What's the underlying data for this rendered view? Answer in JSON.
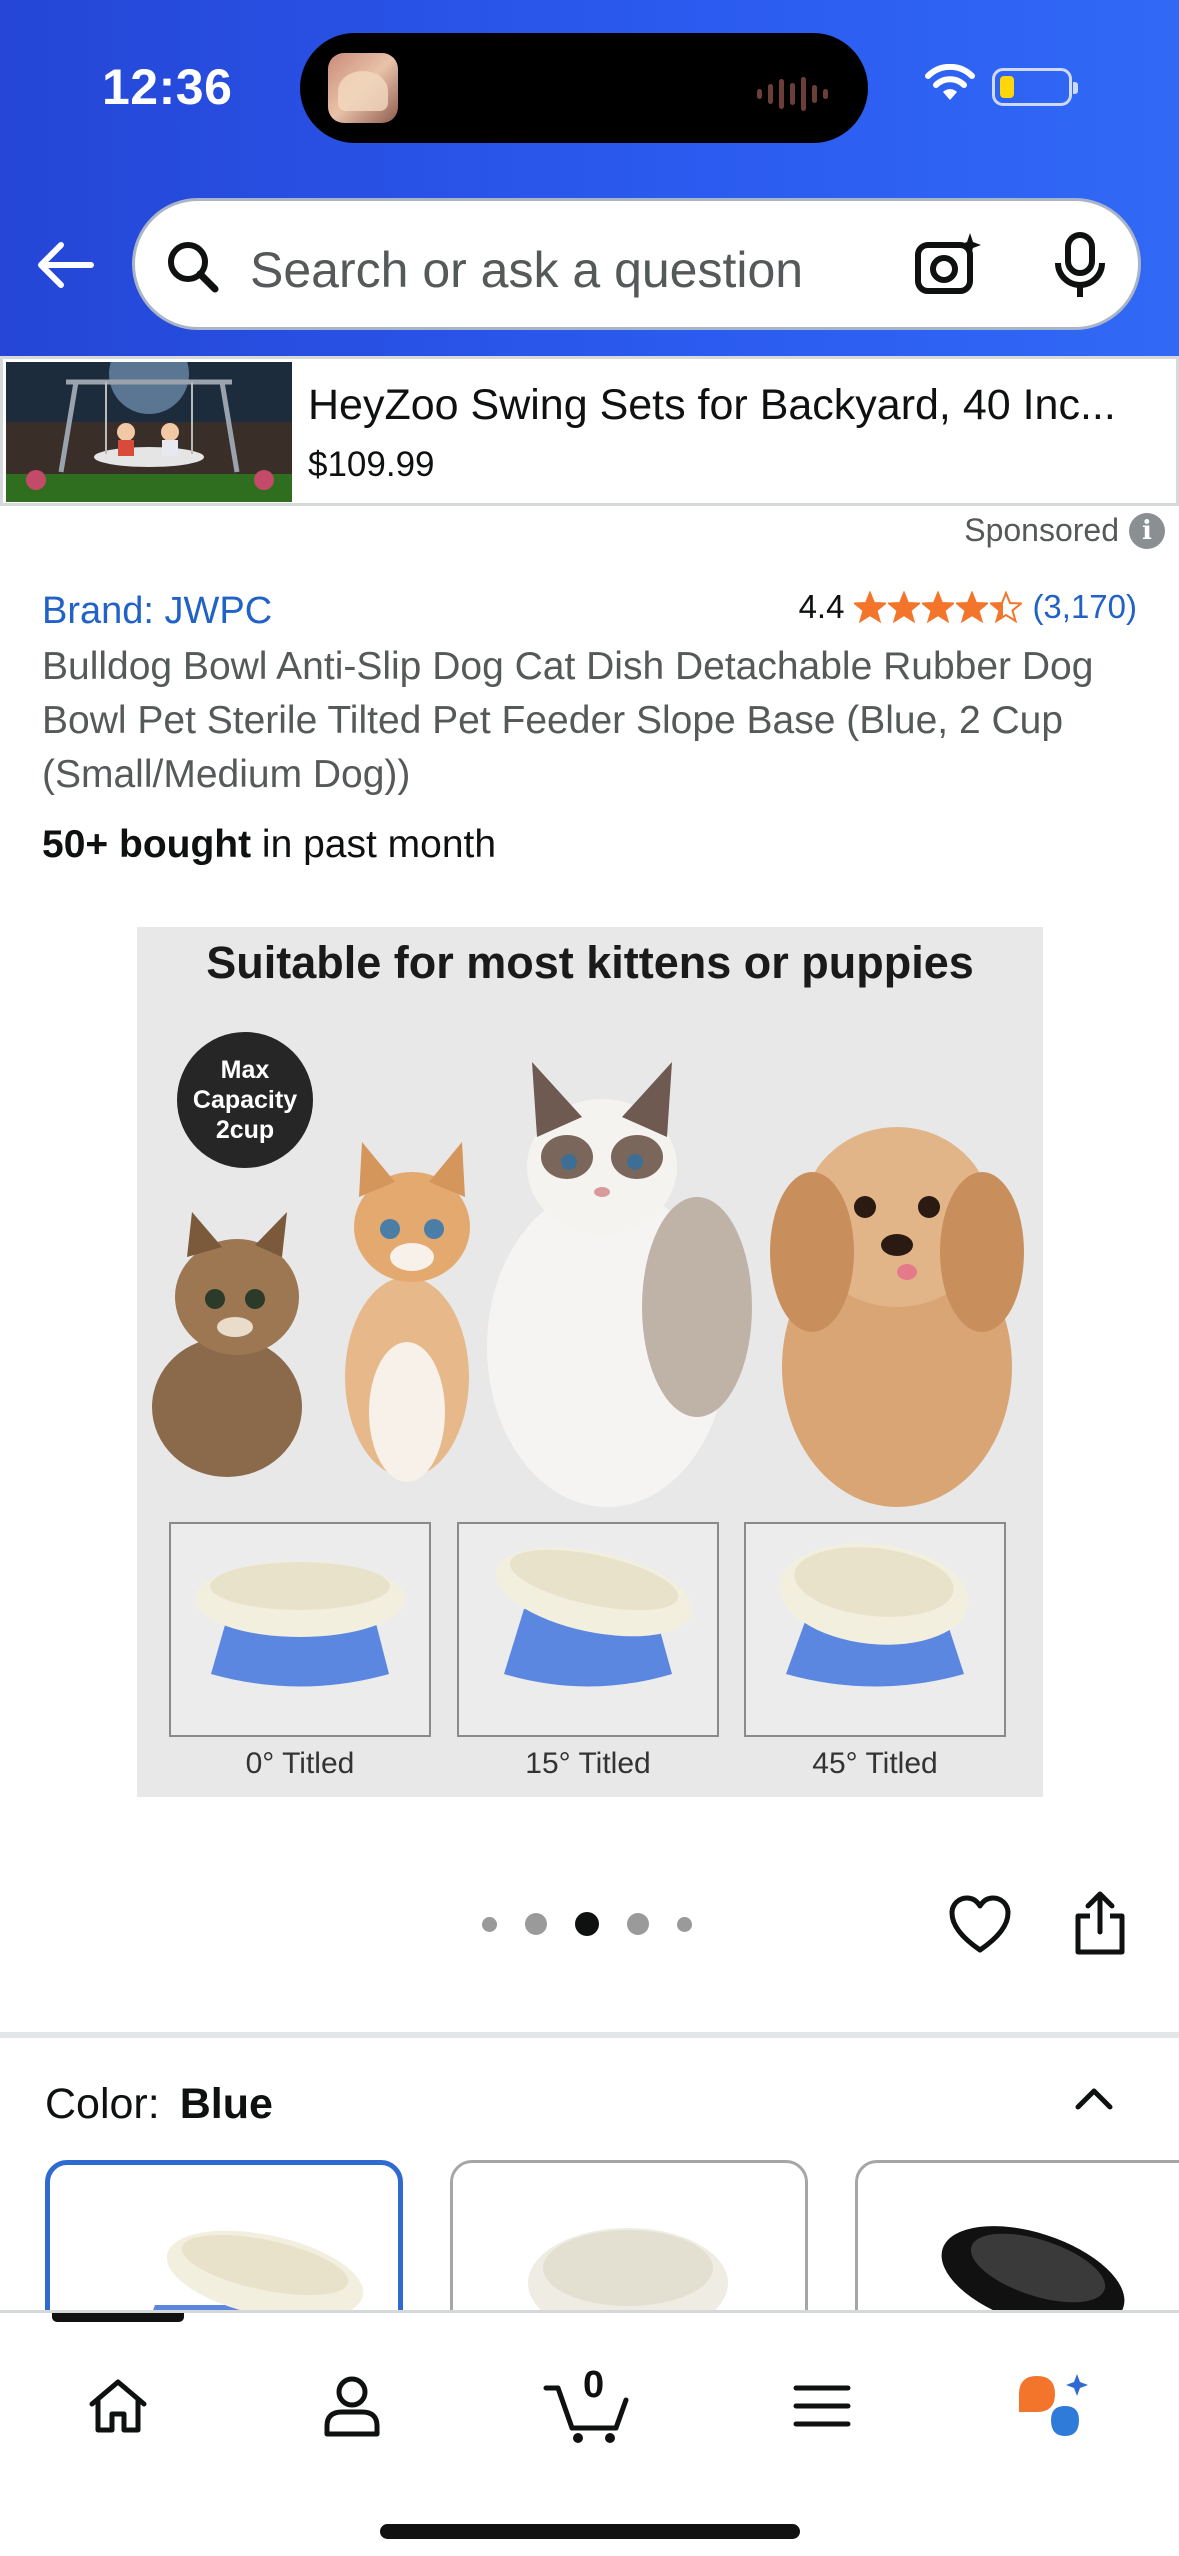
{
  "status_bar": {
    "time": "12:36"
  },
  "search": {
    "placeholder": "Search or ask a question"
  },
  "ad": {
    "title": "HeyZoo Swing Sets for Backyard, 40 Inc...",
    "price": "$109.99",
    "sponsored_label": "Sponsored"
  },
  "product": {
    "brand": "Brand: JWPC",
    "rating": "4.4",
    "rating_stars": 4.4,
    "rating_count": "(3,170)",
    "title": "Bulldog Bowl Anti-Slip Dog Cat Dish Detachable Rubber Dog Bowl Pet Sterile Tilted Pet Feeder Slope Base (Blue, 2 Cup (Small/Medium Dog))",
    "bought_bold": "50+ bought",
    "bought_rest": " in past month"
  },
  "image": {
    "headline": "Suitable for most kittens or puppies",
    "badge": [
      "Max",
      "Capacity",
      "2cup"
    ],
    "bowls": [
      "0° Titled",
      "15° Titled",
      "45° Titled"
    ]
  },
  "carousel": {
    "total": 5,
    "active_index": 2
  },
  "color": {
    "label": "Color:",
    "value": "Blue"
  },
  "nav": {
    "cart_count": "0"
  },
  "colors": {
    "accent_blue": "#2b5bf0",
    "link": "#2162c6",
    "star": "#f3742b",
    "bowl_blue": "#5b87e0"
  }
}
